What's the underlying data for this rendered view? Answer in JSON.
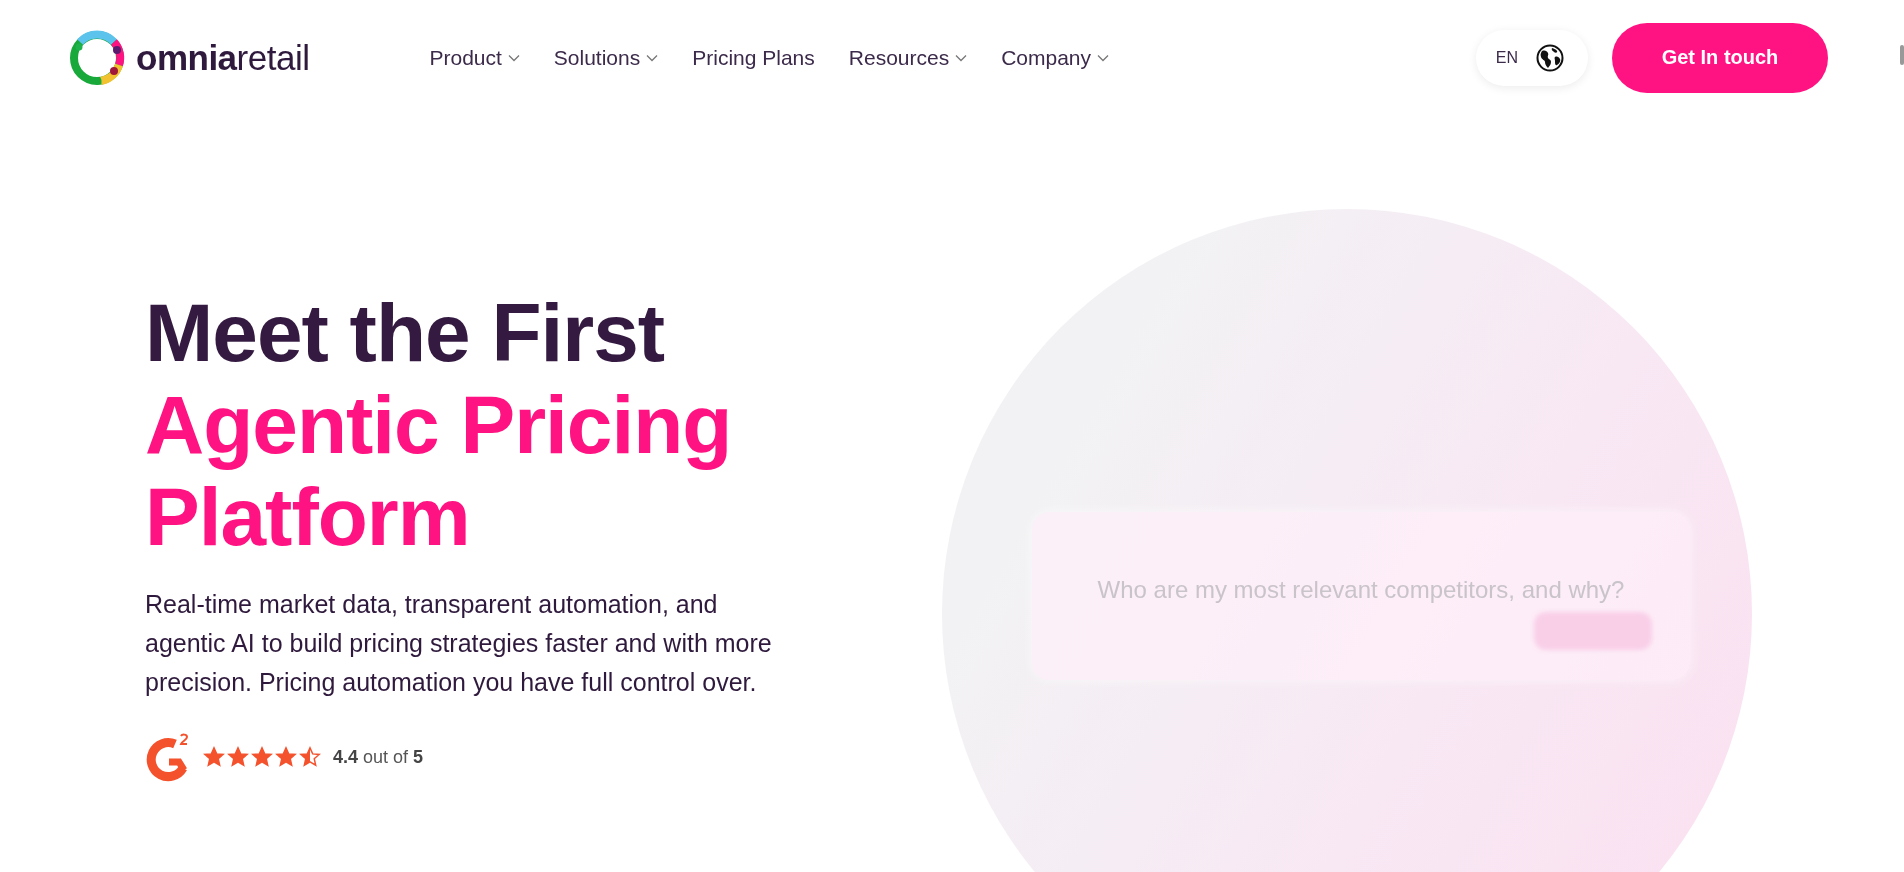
{
  "header": {
    "logo": {
      "text": "**omnia**retail"
    },
    "nav": [
      {
        "label": "Product",
        "dropdown": true
      },
      {
        "label": "Solutions",
        "dropdown": true
      },
      {
        "label": "Pricing Plans",
        "dropdown": false
      },
      {
        "label": "Resources",
        "dropdown": true
      },
      {
        "label": "Company",
        "dropdown": true
      }
    ],
    "language": {
      "label": "EN"
    },
    "cta": {
      "label": "Get In touch"
    }
  },
  "hero": {
    "title": {
      "text": "Meet the First",
      "highlight_lines": [
        "Agentic Pricing",
        "Platform"
      ]
    },
    "description": "Real-time market data, transparent automation, and agentic AI to build pricing strategies faster and with more precision. Pricing automation you have full control over.",
    "rating": {
      "stars": 4.5,
      "text": "**4.4** out of **5**"
    },
    "visual": {
      "prompt": "Who are my most relevant competitors, and why?"
    }
  }
}
